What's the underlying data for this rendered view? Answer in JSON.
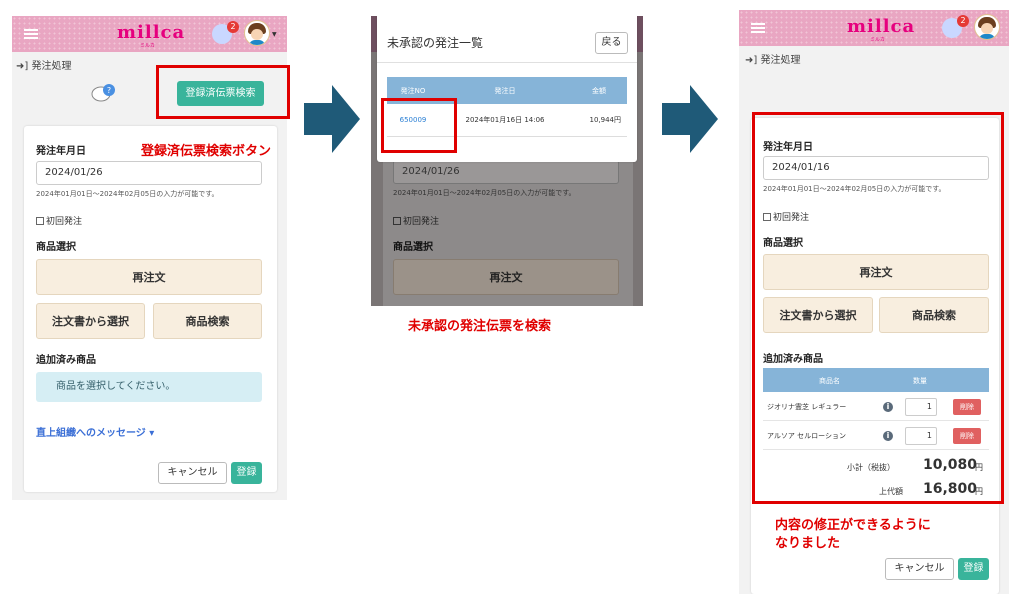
{
  "app": {
    "logo": "millca",
    "logo_sub": "ミルカ",
    "notification_count": "2"
  },
  "panel1": {
    "breadcrumb": "発注処理",
    "search_button": "登録済伝票検索",
    "annotation": "登録済伝票検索ボタン",
    "order_date_label": "発注年月日",
    "order_date_value": "2024/01/26",
    "date_hint": "2024年01月01日～2024年02月05日の入力が可能です。",
    "first_order": "初回発注",
    "product_select_label": "商品選択",
    "reorder_button": "再注文",
    "select_from_order_button": "注文書から選択",
    "product_search_button": "商品検索",
    "added_products_label": "追加済み商品",
    "empty_message": "商品を選択してください。",
    "message_link": "直上組織へのメッセージ ▾",
    "cancel_button": "キャンセル",
    "register_button": "登録"
  },
  "panel2": {
    "modal_title": "未承認の発注一覧",
    "back_button": "戻る",
    "columns": [
      "発注NO",
      "発注日",
      "金額"
    ],
    "rows": [
      {
        "order_no": "650009",
        "date": "2024年01月16日 14:06",
        "amount": "10,944円"
      }
    ],
    "bg_date_value": "2024/01/26",
    "bg_date_hint": "2024年01月01日～2024年02月05日の入力が可能です。",
    "bg_first_order": "初回発注",
    "bg_product_select_label": "商品選択",
    "bg_reorder_button": "再注文",
    "annotation": "未承認の発注伝票を検索"
  },
  "panel3": {
    "breadcrumb": "発注処理",
    "order_date_label": "発注年月日",
    "order_date_value": "2024/01/16",
    "date_hint": "2024年01月01日～2024年02月05日の入力が可能です。",
    "first_order": "初回発注",
    "product_select_label": "商品選択",
    "reorder_button": "再注文",
    "select_from_order_button": "注文書から選択",
    "product_search_button": "商品検索",
    "added_products_label": "追加済み商品",
    "columns": [
      "商品名",
      "数量"
    ],
    "items": [
      {
        "name": "ジオリナ霊芝 レギュラー",
        "qty": "1",
        "delete": "削除"
      },
      {
        "name": "アルソア セルローション",
        "qty": "1",
        "delete": "削除"
      }
    ],
    "subtotal_label": "小計（税抜）",
    "subtotal_value": "10,080",
    "subtotal_unit": "円",
    "retail_label": "上代額",
    "retail_value": "16,800",
    "retail_unit": "円",
    "annotation_line1": "内容の修正ができるように",
    "annotation_line2": "なりました",
    "cancel_button": "キャンセル",
    "register_button": "登録"
  },
  "colors": {
    "header_pink": "#e9a6c2",
    "accent_green": "#39b49b",
    "annotation_red": "#e00000",
    "arrow_blue": "#1f5a78"
  }
}
